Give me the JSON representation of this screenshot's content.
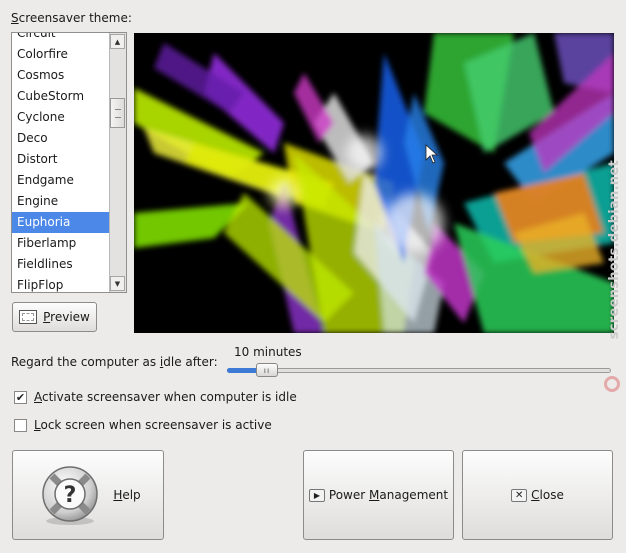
{
  "theme_section": {
    "label_underlined": "S",
    "label_rest": "creensaver theme:",
    "items": [
      "Circuit",
      "Colorfire",
      "Cosmos",
      "CubeStorm",
      "Cyclone",
      "Deco",
      "Distort",
      "Endgame",
      "Engine",
      "Euphoria",
      "Fiberlamp",
      "Fieldlines",
      "FlipFlop"
    ],
    "selected_index": 9,
    "scroll_position": 0.25
  },
  "preview_button": {
    "label_underlined": "P",
    "label_rest": "review"
  },
  "idle": {
    "label_before": "Regard the computer as ",
    "label_underlined": "i",
    "label_after": "dle after:",
    "value_text": "10 minutes",
    "slider_fraction": 0.08
  },
  "activate_checkbox": {
    "checked": true,
    "checkmark": "✔",
    "label_underlined": "A",
    "label_rest": "ctivate screensaver when computer is idle"
  },
  "lock_checkbox": {
    "checked": false,
    "label_underlined": "L",
    "label_rest": "ock screen when screensaver is active"
  },
  "buttons": {
    "help": {
      "label_underlined": "H",
      "label_rest": "elp",
      "glyph": "?"
    },
    "power": {
      "label_before": "Power ",
      "label_underlined": "M",
      "label_after": "anagement",
      "glyph": "▶"
    },
    "close": {
      "label_underlined": "C",
      "label_rest": "lose",
      "glyph": "✕"
    }
  },
  "watermark": "screenshots.debian.net",
  "colors": {
    "selection": "#4c88e8",
    "slider_fill": "#3c7ad6",
    "window_bg": "#ecebe9"
  }
}
